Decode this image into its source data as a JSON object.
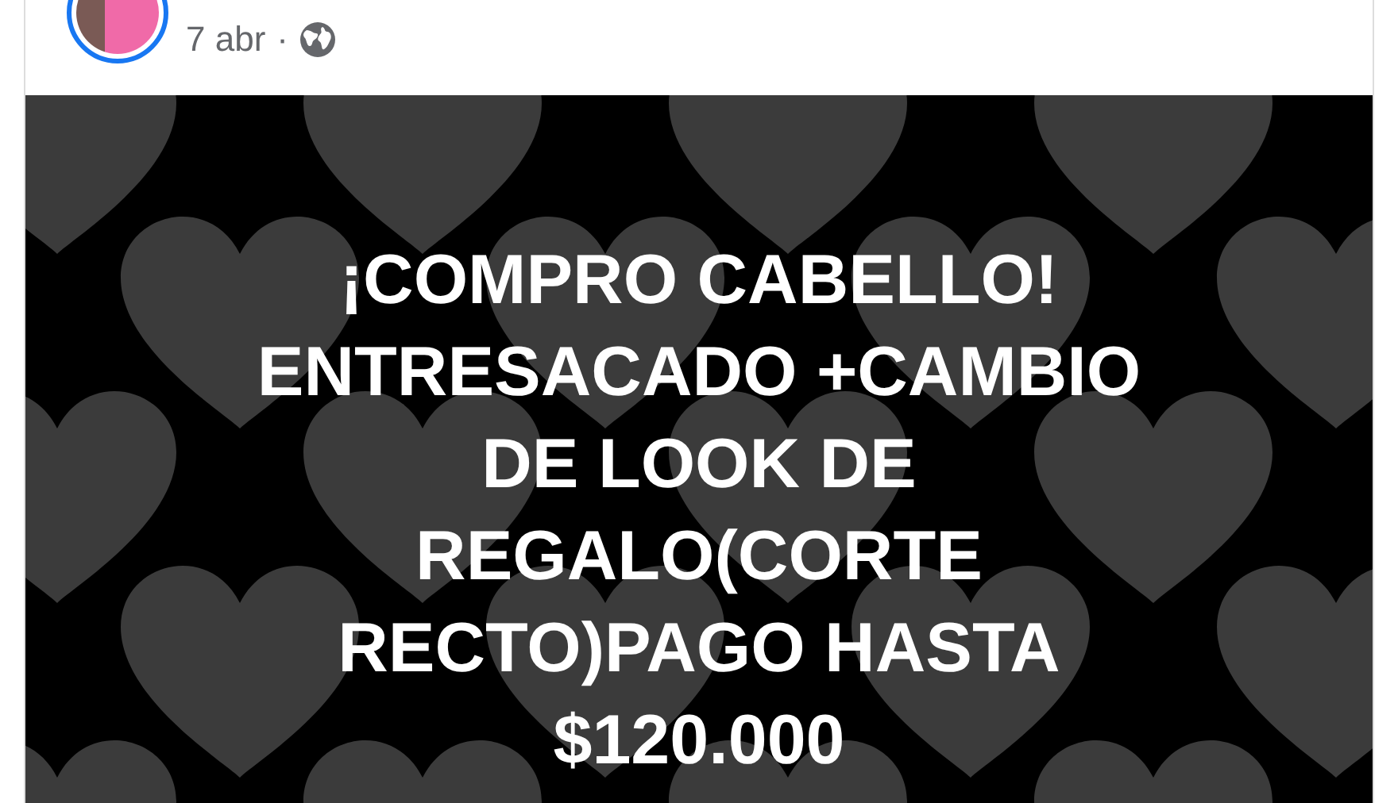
{
  "post": {
    "date": "7 abr",
    "separator": "·",
    "image_text": "¡COMPRO CABELLO!\nENTRESACADO +CAMBIO\nDE LOOK DE\nREGALO(CORTE\nRECTO)PAGO HASTA\n$120.000"
  }
}
